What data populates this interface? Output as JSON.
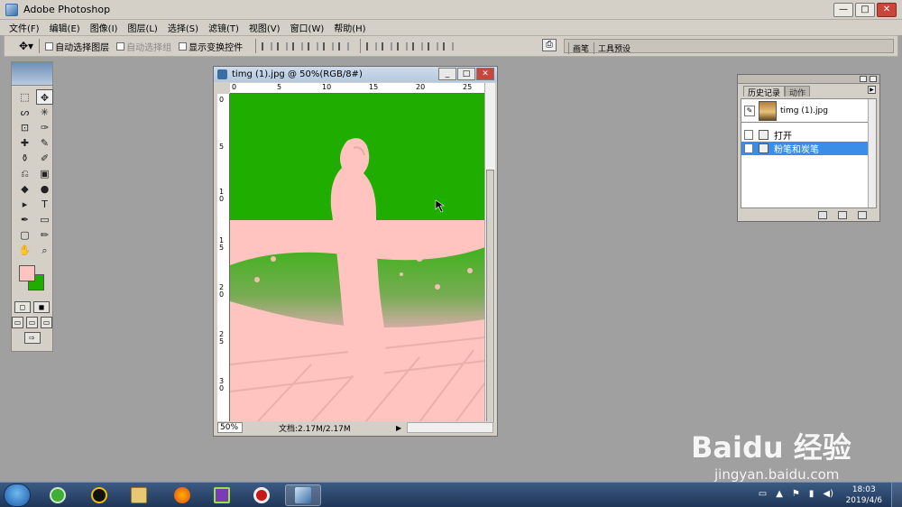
{
  "window": {
    "title": "Adobe Photoshop",
    "min_label": "—",
    "restore_label": "□",
    "close_label": "✕"
  },
  "menu": [
    "文件(F)",
    "编辑(E)",
    "图像(I)",
    "图层(L)",
    "选择(S)",
    "滤镜(T)",
    "视图(V)",
    "窗口(W)",
    "帮助(H)"
  ],
  "options": {
    "auto_select_layer": "自动选择图层",
    "auto_select_group": "自动选择组",
    "show_transform": "显示变换控件",
    "palette_tabs": [
      "画笔",
      "工具预设"
    ]
  },
  "toolbox": {
    "tools": [
      "⬚",
      "✥",
      "ᔕ",
      "✳",
      "⊡",
      "✑",
      "✚",
      "✎",
      "⚱",
      "✐",
      "⎌",
      "▣",
      "◆",
      "●",
      "▸",
      "T",
      "✒",
      "▭",
      "▢",
      "✏",
      "✋",
      "⌕"
    ],
    "colors": {
      "foreground": "#ffc4c0",
      "background": "#1fae00"
    }
  },
  "document": {
    "title": "timg (1).jpg @ 50%(RGB/8#)",
    "ruler_h": [
      "0",
      "5",
      "10",
      "15",
      "20",
      "25"
    ],
    "ruler_v": [
      "0",
      "5",
      "1",
      "0",
      "1",
      "5",
      "2",
      "0",
      "2",
      "5",
      "3",
      "0"
    ],
    "zoom": "50%",
    "status": "文档:2.17M/2.17M"
  },
  "history": {
    "tabs": [
      "历史记录",
      "动作"
    ],
    "snapshot_name": "timg (1).jpg",
    "states": [
      {
        "label": "打开",
        "selected": false
      },
      {
        "label": "粉笔和炭笔",
        "selected": true
      }
    ]
  },
  "watermark": {
    "brand": "Baidu 经验",
    "url": "jingyan.baidu.com"
  },
  "taskbar": {
    "time": "18:03",
    "date": "2019/4/6"
  }
}
